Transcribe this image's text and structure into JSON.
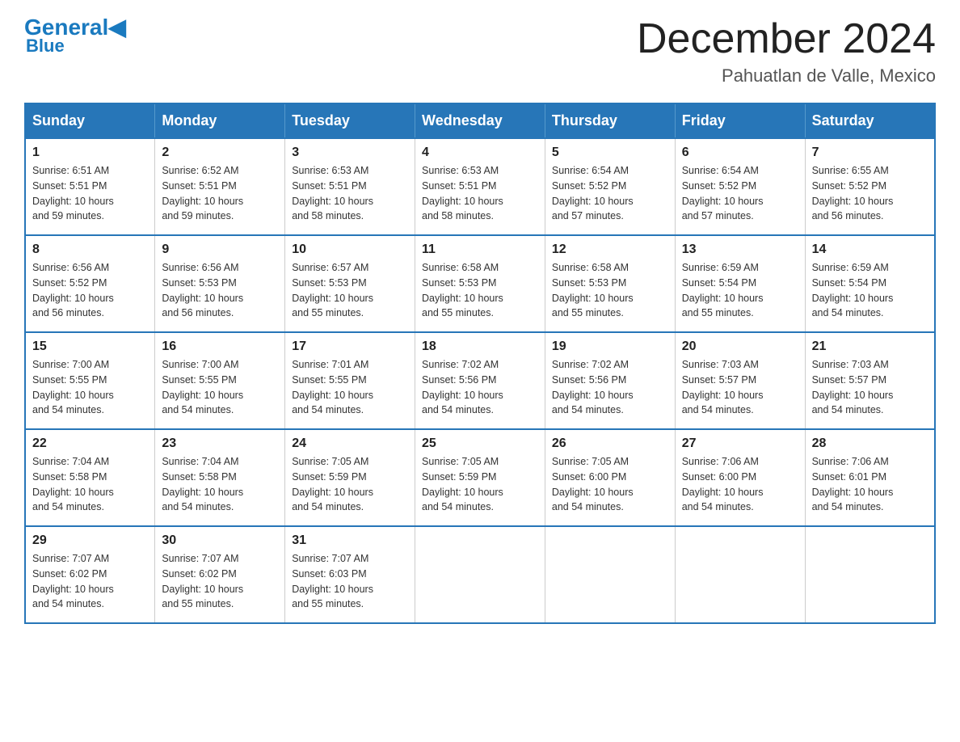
{
  "logo": {
    "general": "General",
    "blue": "Blue"
  },
  "header": {
    "month": "December 2024",
    "location": "Pahuatlan de Valle, Mexico"
  },
  "days_of_week": [
    "Sunday",
    "Monday",
    "Tuesday",
    "Wednesday",
    "Thursday",
    "Friday",
    "Saturday"
  ],
  "weeks": [
    [
      {
        "day": "1",
        "sunrise": "6:51 AM",
        "sunset": "5:51 PM",
        "daylight": "10 hours and 59 minutes."
      },
      {
        "day": "2",
        "sunrise": "6:52 AM",
        "sunset": "5:51 PM",
        "daylight": "10 hours and 59 minutes."
      },
      {
        "day": "3",
        "sunrise": "6:53 AM",
        "sunset": "5:51 PM",
        "daylight": "10 hours and 58 minutes."
      },
      {
        "day": "4",
        "sunrise": "6:53 AM",
        "sunset": "5:51 PM",
        "daylight": "10 hours and 58 minutes."
      },
      {
        "day": "5",
        "sunrise": "6:54 AM",
        "sunset": "5:52 PM",
        "daylight": "10 hours and 57 minutes."
      },
      {
        "day": "6",
        "sunrise": "6:54 AM",
        "sunset": "5:52 PM",
        "daylight": "10 hours and 57 minutes."
      },
      {
        "day": "7",
        "sunrise": "6:55 AM",
        "sunset": "5:52 PM",
        "daylight": "10 hours and 56 minutes."
      }
    ],
    [
      {
        "day": "8",
        "sunrise": "6:56 AM",
        "sunset": "5:52 PM",
        "daylight": "10 hours and 56 minutes."
      },
      {
        "day": "9",
        "sunrise": "6:56 AM",
        "sunset": "5:53 PM",
        "daylight": "10 hours and 56 minutes."
      },
      {
        "day": "10",
        "sunrise": "6:57 AM",
        "sunset": "5:53 PM",
        "daylight": "10 hours and 55 minutes."
      },
      {
        "day": "11",
        "sunrise": "6:58 AM",
        "sunset": "5:53 PM",
        "daylight": "10 hours and 55 minutes."
      },
      {
        "day": "12",
        "sunrise": "6:58 AM",
        "sunset": "5:53 PM",
        "daylight": "10 hours and 55 minutes."
      },
      {
        "day": "13",
        "sunrise": "6:59 AM",
        "sunset": "5:54 PM",
        "daylight": "10 hours and 55 minutes."
      },
      {
        "day": "14",
        "sunrise": "6:59 AM",
        "sunset": "5:54 PM",
        "daylight": "10 hours and 54 minutes."
      }
    ],
    [
      {
        "day": "15",
        "sunrise": "7:00 AM",
        "sunset": "5:55 PM",
        "daylight": "10 hours and 54 minutes."
      },
      {
        "day": "16",
        "sunrise": "7:00 AM",
        "sunset": "5:55 PM",
        "daylight": "10 hours and 54 minutes."
      },
      {
        "day": "17",
        "sunrise": "7:01 AM",
        "sunset": "5:55 PM",
        "daylight": "10 hours and 54 minutes."
      },
      {
        "day": "18",
        "sunrise": "7:02 AM",
        "sunset": "5:56 PM",
        "daylight": "10 hours and 54 minutes."
      },
      {
        "day": "19",
        "sunrise": "7:02 AM",
        "sunset": "5:56 PM",
        "daylight": "10 hours and 54 minutes."
      },
      {
        "day": "20",
        "sunrise": "7:03 AM",
        "sunset": "5:57 PM",
        "daylight": "10 hours and 54 minutes."
      },
      {
        "day": "21",
        "sunrise": "7:03 AM",
        "sunset": "5:57 PM",
        "daylight": "10 hours and 54 minutes."
      }
    ],
    [
      {
        "day": "22",
        "sunrise": "7:04 AM",
        "sunset": "5:58 PM",
        "daylight": "10 hours and 54 minutes."
      },
      {
        "day": "23",
        "sunrise": "7:04 AM",
        "sunset": "5:58 PM",
        "daylight": "10 hours and 54 minutes."
      },
      {
        "day": "24",
        "sunrise": "7:05 AM",
        "sunset": "5:59 PM",
        "daylight": "10 hours and 54 minutes."
      },
      {
        "day": "25",
        "sunrise": "7:05 AM",
        "sunset": "5:59 PM",
        "daylight": "10 hours and 54 minutes."
      },
      {
        "day": "26",
        "sunrise": "7:05 AM",
        "sunset": "6:00 PM",
        "daylight": "10 hours and 54 minutes."
      },
      {
        "day": "27",
        "sunrise": "7:06 AM",
        "sunset": "6:00 PM",
        "daylight": "10 hours and 54 minutes."
      },
      {
        "day": "28",
        "sunrise": "7:06 AM",
        "sunset": "6:01 PM",
        "daylight": "10 hours and 54 minutes."
      }
    ],
    [
      {
        "day": "29",
        "sunrise": "7:07 AM",
        "sunset": "6:02 PM",
        "daylight": "10 hours and 54 minutes."
      },
      {
        "day": "30",
        "sunrise": "7:07 AM",
        "sunset": "6:02 PM",
        "daylight": "10 hours and 55 minutes."
      },
      {
        "day": "31",
        "sunrise": "7:07 AM",
        "sunset": "6:03 PM",
        "daylight": "10 hours and 55 minutes."
      },
      null,
      null,
      null,
      null
    ]
  ],
  "labels": {
    "sunrise": "Sunrise:",
    "sunset": "Sunset:",
    "daylight": "Daylight:"
  }
}
